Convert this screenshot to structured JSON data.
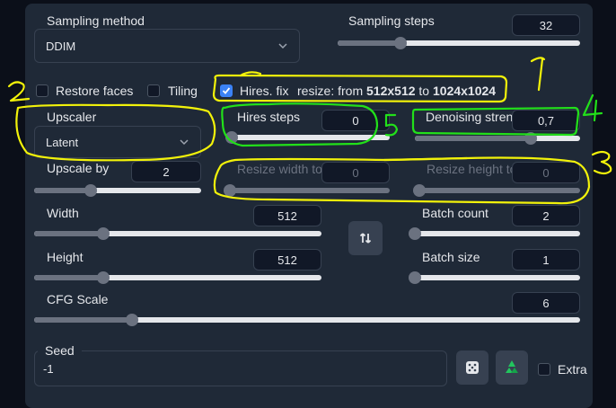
{
  "sampling": {
    "method_label": "Sampling method",
    "method_value": "DDIM",
    "steps_label": "Sampling steps",
    "steps_value": "32",
    "steps_fraction": 0.26
  },
  "toggles": {
    "restore_faces": "Restore faces",
    "tiling": "Tiling",
    "hires_fix": "Hires. fix",
    "resize_prefix": "resize: from",
    "resize_from": "512x512",
    "resize_to_word": "to",
    "resize_to": "1024x1024"
  },
  "hires": {
    "upscaler_label": "Upscaler",
    "upscaler_value": "Latent",
    "hires_steps_label": "Hires steps",
    "hires_steps_value": "0",
    "hires_steps_fraction": 0.0,
    "denoising_label": "Denoising streng",
    "denoising_value": "0,7",
    "denoising_fraction": 0.7,
    "upscale_by_label": "Upscale by",
    "upscale_by_value": "2",
    "upscale_by_fraction": 0.34,
    "resize_width_label": "Resize width to",
    "resize_width_value": "0",
    "resize_height_label": "Resize height to",
    "resize_height_value": "0"
  },
  "size": {
    "width_label": "Width",
    "width_value": "512",
    "width_fraction": 0.24,
    "height_label": "Height",
    "height_value": "512",
    "height_fraction": 0.24,
    "swap_icon": "swap-vertical-icon"
  },
  "batch": {
    "count_label": "Batch count",
    "count_value": "2",
    "count_fraction": 0.0,
    "size_label": "Batch size",
    "size_value": "1",
    "size_fraction": 0.0
  },
  "cfg": {
    "label": "CFG Scale",
    "value": "6",
    "fraction": 0.18
  },
  "seed": {
    "label": "Seed",
    "value": "-1",
    "dice_icon": "dice-icon",
    "recycle_icon": "recycle-icon",
    "extra_label": "Extra"
  },
  "annotations": {
    "one": "1",
    "two": "2",
    "three": "3",
    "four": "4",
    "five": "5"
  },
  "colors": {
    "panel": "#1f2937",
    "background": "#0b0f19",
    "accent_blue": "#3b82f6",
    "annotation_yellow": "#f2f20a",
    "annotation_green": "#22e01a",
    "recycle_green": "#22c55e"
  }
}
